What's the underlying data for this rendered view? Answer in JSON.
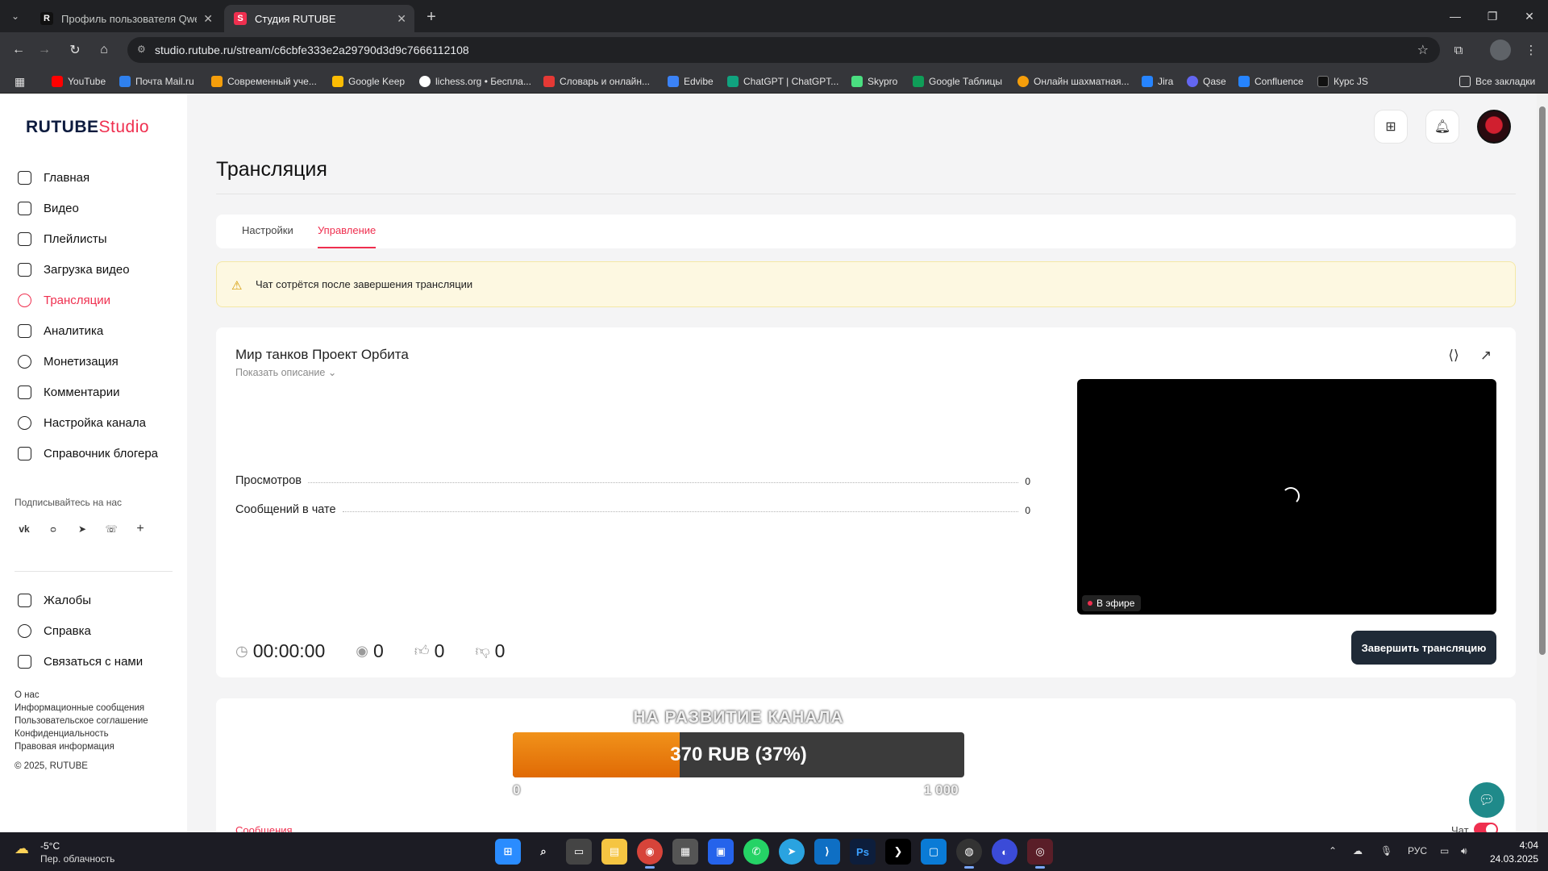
{
  "browser": {
    "tabs": [
      {
        "title": "Профиль пользователя Qwert",
        "favicon": "R",
        "favicon_color": "#111111"
      },
      {
        "title": "Студия RUTUBE",
        "favicon": "S",
        "favicon_color": "#ef2f4f"
      }
    ],
    "url": "studio.rutube.ru/stream/c6cbfe333e2a29790d3d9c7666112108",
    "bookmarks": [
      {
        "label": "YouTube",
        "color": "#ff0000"
      },
      {
        "label": "Почта Mail.ru",
        "color": "#2f80ed"
      },
      {
        "label": "Современный уче...",
        "color": "#f59e0b"
      },
      {
        "label": "Google Keep",
        "color": "#fbbc04"
      },
      {
        "label": "lichess.org • Беспла...",
        "color": "#ffffff"
      },
      {
        "label": "Словарь и онлайн...",
        "color": "#e53935"
      },
      {
        "label": "Edvibe",
        "color": "#3b82f6"
      },
      {
        "label": "ChatGPT | ChatGPT...",
        "color": "#10a37f"
      },
      {
        "label": "Skypro",
        "color": "#4ade80"
      },
      {
        "label": "Google Таблицы",
        "color": "#0f9d58"
      },
      {
        "label": "Онлайн шахматная...",
        "color": "#f59e0b"
      },
      {
        "label": "Jira",
        "color": "#2684ff"
      },
      {
        "label": "Qase",
        "color": "#6366f1"
      },
      {
        "label": "Confluence",
        "color": "#2684ff"
      },
      {
        "label": "Курс JS",
        "color": "#111111"
      }
    ],
    "all_bookmarks": "Все закладки"
  },
  "app": {
    "logo_main": "RUTUBE",
    "logo_sub": "Studio",
    "accent": "#ef2f4f"
  },
  "sidebar": {
    "items": [
      {
        "label": "Главная",
        "icon": "home-icon"
      },
      {
        "label": "Видео",
        "icon": "video-icon"
      },
      {
        "label": "Плейлисты",
        "icon": "playlist-icon"
      },
      {
        "label": "Загрузка видео",
        "icon": "upload-icon"
      },
      {
        "label": "Трансляции",
        "icon": "broadcast-icon",
        "active": true
      },
      {
        "label": "Аналитика",
        "icon": "analytics-icon"
      },
      {
        "label": "Монетизация",
        "icon": "ruble-icon"
      },
      {
        "label": "Комментарии",
        "icon": "comments-icon"
      },
      {
        "label": "Настройка канала",
        "icon": "gear-icon"
      },
      {
        "label": "Справочник блогера",
        "icon": "book-icon"
      }
    ],
    "follow_label": "Подписывайтесь на нас",
    "socials": [
      "vk-icon",
      "ok-icon",
      "telegram-icon",
      "viber-icon",
      "plus-icon"
    ],
    "bottom_items": [
      {
        "label": "Жалобы",
        "icon": "flag-icon"
      },
      {
        "label": "Справка",
        "icon": "help-icon"
      },
      {
        "label": "Связаться с нами",
        "icon": "mail-icon"
      }
    ],
    "footer_links": [
      "О нас",
      "Информационные сообщения",
      "Пользовательское соглашение",
      "Конфиденциальность",
      "Правовая информация"
    ],
    "copyright": "© 2025, RUTUBE"
  },
  "header": {
    "title": "Трансляция",
    "tabs": [
      "Настройки",
      "Управление"
    ],
    "active_tab": "Управление"
  },
  "warning": {
    "text": "Чат сотрётся после завершения трансляции"
  },
  "stream": {
    "title": "Мир танков Проект Орбита",
    "show_description": "Показать описание",
    "stats": [
      {
        "label": "Просмотров",
        "value": "0"
      },
      {
        "label": "Сообщений в чате",
        "value": "0"
      }
    ],
    "duration": "00:00:00",
    "viewers": "0",
    "likes": "0",
    "dislikes": "0",
    "live_label": "В эфире",
    "end_button": "Завершить трансляцию"
  },
  "chat": {
    "tab": "Сообщения",
    "toggle_label": "Чат",
    "enabled": true
  },
  "donation": {
    "title": "НА РАЗВИТИЕ КАНАЛА",
    "amount_text": "370 RUB (37%)",
    "progress": 0.37,
    "min": "0",
    "max": "1 000"
  },
  "taskbar": {
    "temperature": "-5°C",
    "weather": "Пер. облачность",
    "language": "РУС",
    "time": "4:04",
    "date": "24.03.2025"
  }
}
